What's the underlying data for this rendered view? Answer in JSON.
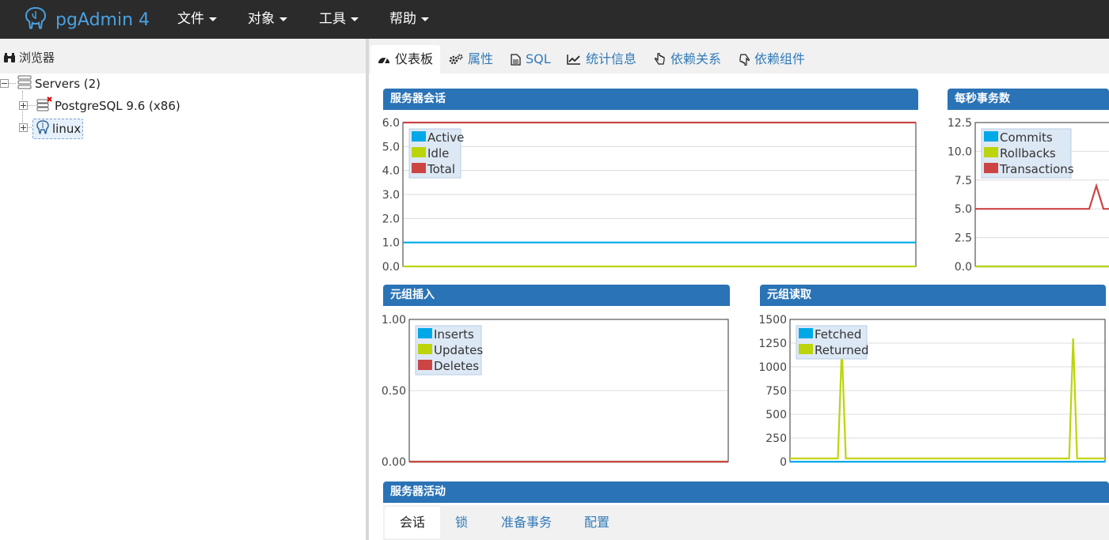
{
  "app": {
    "title": "pgAdmin 4"
  },
  "menu": [
    {
      "label": "文件"
    },
    {
      "label": "对象"
    },
    {
      "label": "工具"
    },
    {
      "label": "帮助"
    }
  ],
  "browser": {
    "title": "浏览器",
    "tree": [
      {
        "label": "Servers (2)"
      },
      {
        "label": "PostgreSQL 9.6 (x86)"
      },
      {
        "label": "linux"
      }
    ]
  },
  "tabs": [
    {
      "label": "仪表板",
      "icon": "dashboard-icon"
    },
    {
      "label": "属性",
      "icon": "gears-icon"
    },
    {
      "label": "SQL",
      "icon": "file-icon"
    },
    {
      "label": "统计信息",
      "icon": "line-chart-icon"
    },
    {
      "label": "依赖关系",
      "icon": "hand-pointer-icon"
    },
    {
      "label": "依赖组件",
      "icon": "hand-point-icon"
    }
  ],
  "colors": {
    "series1": "#00a8e8",
    "series2": "#bcd40a",
    "series3": "#cc4444",
    "panel_header": "#2a73b6"
  },
  "panels": {
    "sessions": "服务器会话",
    "transactions": "每秒事务数",
    "tuples_in": "元组插入",
    "tuples_out": "元组读取",
    "activity": "服务器活动"
  },
  "chart_data": [
    {
      "type": "line",
      "title": "服务器会话",
      "ylim": [
        0,
        6
      ],
      "yticks": [
        "0.0",
        "1.0",
        "2.0",
        "3.0",
        "4.0",
        "5.0",
        "6.0"
      ],
      "legend_position": "top-left",
      "series": [
        {
          "name": "Active",
          "color": "#00a8e8",
          "values": [
            1,
            1,
            1,
            1,
            1,
            1,
            1,
            1,
            1,
            1,
            1,
            1,
            1,
            1,
            1,
            1,
            1,
            1,
            1,
            1,
            1
          ]
        },
        {
          "name": "Idle",
          "color": "#bcd40a",
          "values": [
            0,
            0,
            0,
            0,
            0,
            0,
            0,
            0,
            0,
            0,
            0,
            0,
            0,
            0,
            0,
            0,
            0,
            0,
            0,
            0,
            0
          ]
        },
        {
          "name": "Total",
          "color": "#cc4444",
          "values": [
            6,
            6,
            6,
            6,
            6,
            6,
            6,
            6,
            6,
            6,
            6,
            6,
            6,
            6,
            6,
            6,
            6,
            6,
            6,
            6,
            6
          ]
        }
      ]
    },
    {
      "type": "line",
      "title": "每秒事务数",
      "ylim": [
        0,
        12.5
      ],
      "yticks": [
        "0.0",
        "2.5",
        "5.0",
        "7.5",
        "10.0",
        "12.5"
      ],
      "legend_position": "top-left",
      "series": [
        {
          "name": "Commits",
          "color": "#00a8e8",
          "values": [
            0,
            0,
            0,
            0,
            0,
            0,
            0,
            0,
            0,
            0,
            0,
            0,
            0,
            0,
            0,
            0,
            0,
            0,
            0,
            0,
            0
          ]
        },
        {
          "name": "Rollbacks",
          "color": "#bcd40a",
          "values": [
            0,
            0,
            0,
            0,
            0,
            0,
            0,
            0,
            0,
            0,
            0,
            0,
            0,
            0,
            0,
            0,
            0,
            0,
            0,
            0,
            0
          ]
        },
        {
          "name": "Transactions",
          "color": "#cc4444",
          "values": [
            5,
            5,
            5,
            5,
            5,
            5,
            5,
            5,
            5,
            5,
            5,
            5,
            5,
            5,
            5,
            5,
            5,
            7,
            5,
            5,
            5
          ]
        }
      ]
    },
    {
      "type": "line",
      "title": "元组插入",
      "ylim": [
        0,
        1
      ],
      "yticks": [
        "0.00",
        "0.50",
        "1.00"
      ],
      "legend_position": "top-left",
      "series": [
        {
          "name": "Inserts",
          "color": "#00a8e8",
          "values": [
            0,
            0,
            0,
            0,
            0,
            0,
            0,
            0,
            0,
            0,
            0,
            0,
            0,
            0,
            0,
            0,
            0,
            0,
            0,
            0,
            0
          ]
        },
        {
          "name": "Updates",
          "color": "#bcd40a",
          "values": [
            0,
            0,
            0,
            0,
            0,
            0,
            0,
            0,
            0,
            0,
            0,
            0,
            0,
            0,
            0,
            0,
            0,
            0,
            0,
            0,
            0
          ]
        },
        {
          "name": "Deletes",
          "color": "#cc4444",
          "values": [
            0,
            0,
            0,
            0,
            0,
            0,
            0,
            0,
            0,
            0,
            0,
            0,
            0,
            0,
            0,
            0,
            0,
            0,
            0,
            0,
            0
          ]
        }
      ]
    },
    {
      "type": "line",
      "title": "元组读取",
      "ylim": [
        0,
        1500
      ],
      "yticks": [
        "0",
        "250",
        "500",
        "750",
        "1000",
        "1250",
        "1500"
      ],
      "legend_position": "top-left",
      "series": [
        {
          "name": "Fetched",
          "color": "#00a8e8",
          "values": [
            0,
            0,
            0,
            0,
            0,
            0,
            0,
            0,
            0,
            0,
            0,
            0,
            0,
            0,
            0,
            0,
            0,
            0,
            0,
            0,
            0,
            0,
            0,
            0,
            0,
            0,
            0,
            0,
            0,
            0,
            0,
            0,
            0,
            0,
            0,
            0,
            0,
            0,
            0,
            0,
            0,
            0,
            0,
            0,
            0,
            0,
            0,
            0,
            0,
            0,
            0,
            0,
            0,
            0,
            0,
            0,
            0,
            0,
            0,
            0,
            0,
            0,
            0,
            0,
            0,
            0,
            0,
            0,
            0,
            0,
            0,
            0,
            0,
            0,
            0,
            0,
            0,
            0,
            0,
            0
          ]
        },
        {
          "name": "Returned",
          "color": "#bcd40a",
          "values": [
            35,
            35,
            35,
            35,
            35,
            35,
            35,
            35,
            35,
            35,
            35,
            35,
            35,
            1200,
            35,
            35,
            35,
            35,
            35,
            35,
            35,
            35,
            35,
            35,
            35,
            35,
            35,
            35,
            35,
            35,
            35,
            35,
            35,
            35,
            35,
            35,
            35,
            35,
            35,
            35,
            35,
            35,
            35,
            35,
            35,
            35,
            35,
            35,
            35,
            35,
            35,
            35,
            35,
            35,
            35,
            35,
            35,
            35,
            35,
            35,
            35,
            35,
            35,
            35,
            35,
            35,
            35,
            35,
            35,
            35,
            35,
            1300,
            35,
            35,
            35,
            35,
            35,
            35,
            35,
            35
          ]
        }
      ]
    }
  ],
  "activity_tabs": [
    {
      "label": "会话"
    },
    {
      "label": "锁"
    },
    {
      "label": "准备事务"
    },
    {
      "label": "配置"
    }
  ]
}
